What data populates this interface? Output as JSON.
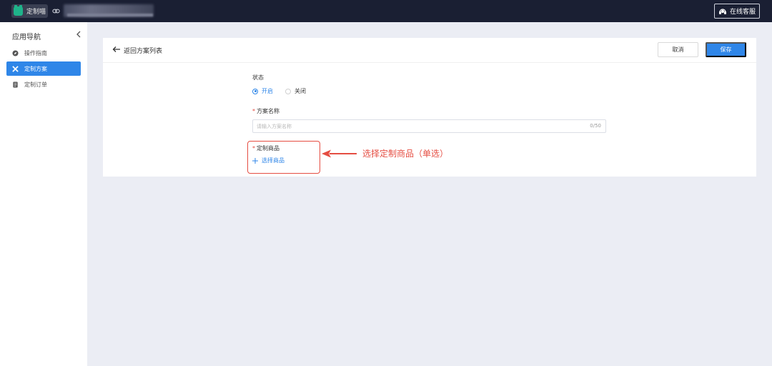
{
  "topbar": {
    "app_name": "定制喵",
    "service_button": "在线客服"
  },
  "sidebar": {
    "title": "应用导航",
    "items": [
      {
        "label": "操作指南",
        "icon": "compass-icon",
        "active": false
      },
      {
        "label": "定制方案",
        "icon": "tools-icon",
        "active": true
      },
      {
        "label": "定制订单",
        "icon": "document-icon",
        "active": false
      }
    ]
  },
  "panel": {
    "back_label": "返回方案列表",
    "cancel_label": "取消",
    "save_label": "保存",
    "status": {
      "label": "状态",
      "options": [
        "开启",
        "关闭"
      ],
      "selected": "开启"
    },
    "plan_name": {
      "label": "方案名称",
      "placeholder": "请输入方案名称",
      "counter": "0/50"
    },
    "product": {
      "label": "定制商品",
      "select_label": "选择商品"
    }
  },
  "annotation": {
    "text": "选择定制商品（单选）",
    "color": "#e54d42"
  },
  "colors": {
    "accent": "#2f86e8",
    "topbar": "#1a1f33",
    "background": "#ebedf4"
  }
}
